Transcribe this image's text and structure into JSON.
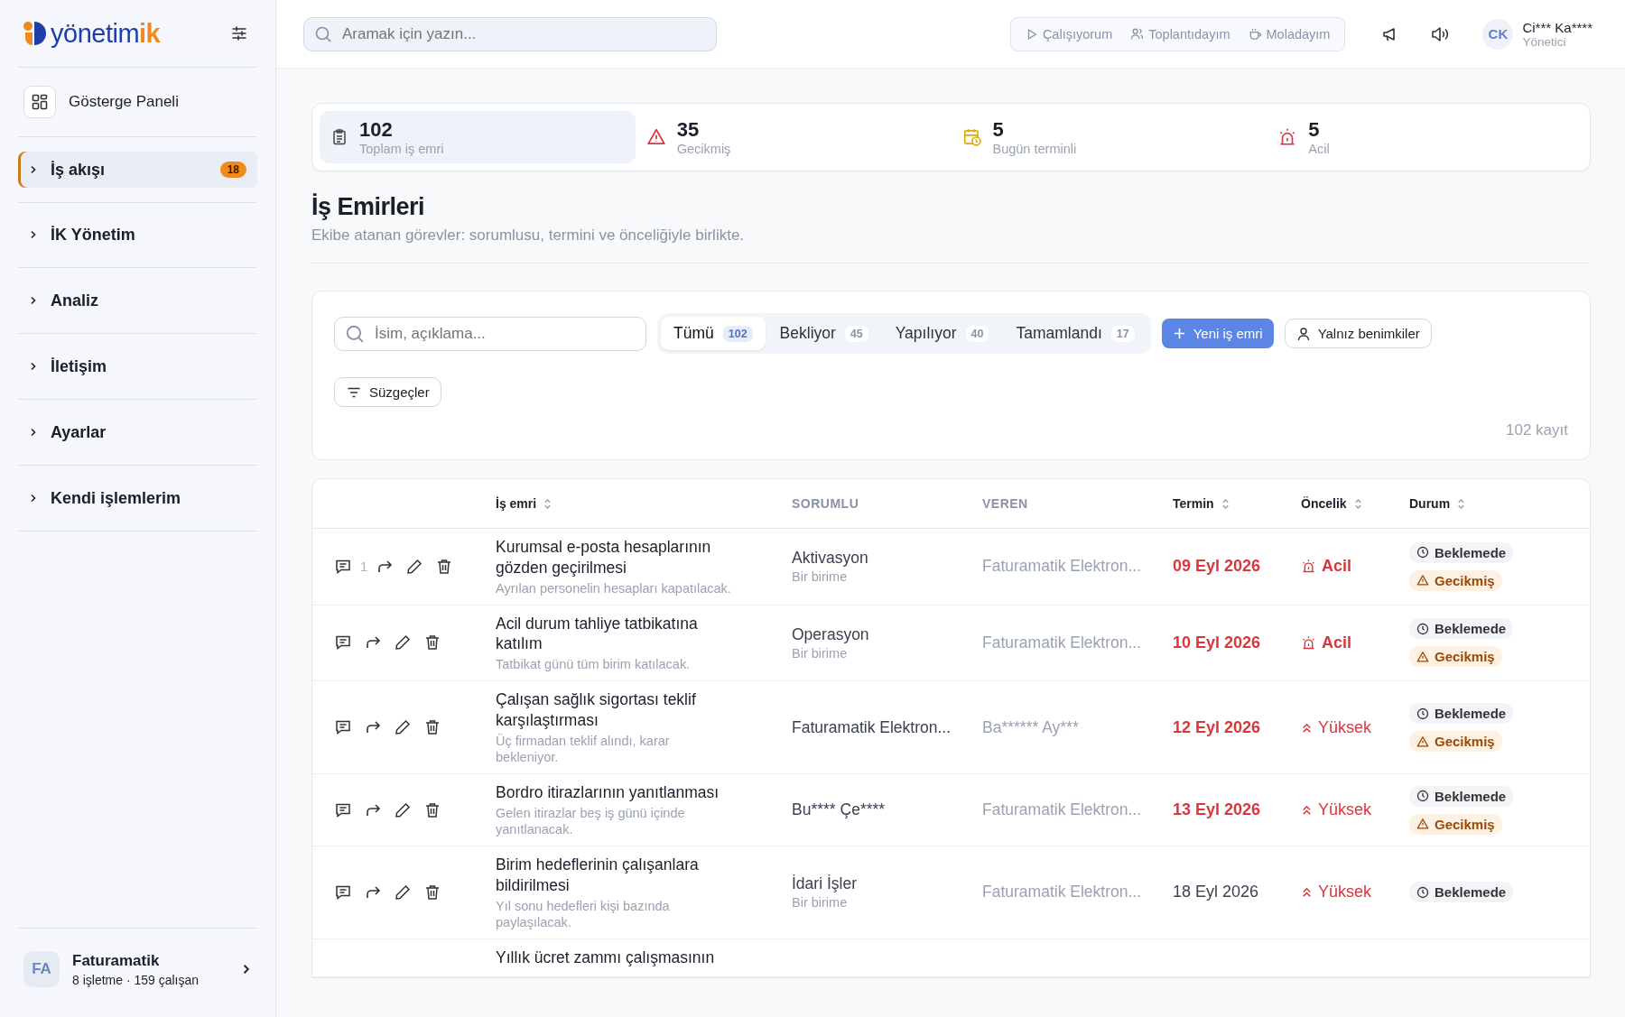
{
  "sidebar": {
    "logo": {
      "text": "yönetim",
      "accent": "ik"
    },
    "items": [
      {
        "label": "Gösterge Paneli",
        "kind": "link",
        "selected": false
      },
      {
        "label": "İş akışı",
        "kind": "group",
        "selected": true,
        "expanded": false,
        "badge": "18"
      },
      {
        "label": "İK Yönetim",
        "kind": "group",
        "selected": false,
        "expanded": false
      },
      {
        "label": "Analiz",
        "kind": "group",
        "selected": false,
        "expanded": false
      },
      {
        "label": "İletişim",
        "kind": "group",
        "selected": false,
        "expanded": false
      },
      {
        "label": "Ayarlar",
        "kind": "group",
        "selected": false,
        "expanded": false
      },
      {
        "label": "Kendi işlemlerim",
        "kind": "group",
        "selected": false,
        "expanded": false
      }
    ],
    "footer": {
      "initials": "FA",
      "name": "Faturamatik",
      "meta": "8 işletme · 159 çalışan"
    }
  },
  "topbar": {
    "search": {
      "placeholder": "Aramak için yazın..."
    },
    "status_buttons": [
      {
        "label": "Çalışıyorum",
        "kind": "working"
      },
      {
        "label": "Toplantıdayım",
        "kind": "meeting"
      },
      {
        "label": "Moladayım",
        "kind": "break"
      }
    ],
    "user": {
      "initials": "CK",
      "name": "Ci*** Ka****",
      "role": "Yönetici"
    }
  },
  "stats": [
    {
      "value": "102",
      "label": "Toplam iş emri",
      "kind": "total",
      "selected": true
    },
    {
      "value": "35",
      "label": "Gecikmiş",
      "kind": "late",
      "selected": false
    },
    {
      "value": "5",
      "label": "Bugün terminli",
      "kind": "today",
      "selected": false
    },
    {
      "value": "5",
      "label": "Acil",
      "kind": "urgent",
      "selected": false
    }
  ],
  "page": {
    "title": "İş Emirleri",
    "subtitle": "Ekibe atanan görevler: sorumlusu, termini ve önceliğiyle birlikte."
  },
  "filters": {
    "search": {
      "placeholder": "İsim, açıklama..."
    },
    "tabs": [
      {
        "label": "Tümü",
        "count": "102",
        "selected": true
      },
      {
        "label": "Bekliyor",
        "count": "45",
        "selected": false
      },
      {
        "label": "Yapılıyor",
        "count": "40",
        "selected": false
      },
      {
        "label": "Tamamlandı",
        "count": "17",
        "selected": false
      }
    ],
    "new_button": "Yeni iş emri",
    "mine_button": "Yalnız benimkiler",
    "filter_button": "Süzgeçler",
    "record_count": "102 kayıt"
  },
  "table": {
    "columns": [
      {
        "label": "İş emri",
        "sortable": true
      },
      {
        "label": "SORUMLU",
        "sortable": false
      },
      {
        "label": "VEREN",
        "sortable": false
      },
      {
        "label": "Termin",
        "sortable": true
      },
      {
        "label": "Öncelik",
        "sortable": true
      },
      {
        "label": "Durum",
        "sortable": true
      }
    ],
    "rows": [
      {
        "comment_count": "1",
        "title": "Kurumsal e-posta hesaplarının gözden geçirilmesi",
        "description": "Ayrılan personelin hesapları kapatılacak.",
        "assignee": "Aktivasyon",
        "assignee_note": "Bir birime",
        "giver": "Faturamatik Elektron...",
        "due": "09 Eyl 2026",
        "overdue": true,
        "priority": {
          "kind": "urgent",
          "label": "Acil"
        },
        "statuses": [
          {
            "kind": "pending",
            "label": "Beklemede"
          },
          {
            "kind": "late",
            "label": "Gecikmiş"
          }
        ]
      },
      {
        "title": "Acil durum tahliye tatbikatına katılım",
        "description": "Tatbikat günü tüm birim katılacak.",
        "assignee": "Operasyon",
        "assignee_note": "Bir birime",
        "giver": "Faturamatik Elektron...",
        "due": "10 Eyl 2026",
        "overdue": true,
        "priority": {
          "kind": "urgent",
          "label": "Acil"
        },
        "statuses": [
          {
            "kind": "pending",
            "label": "Beklemede"
          },
          {
            "kind": "late",
            "label": "Gecikmiş"
          }
        ]
      },
      {
        "title": "Çalışan sağlık sigortası teklif karşılaştırması",
        "description": "Üç firmadan teklif alındı, karar bekleniyor.",
        "assignee": "Faturamatik Elektron...",
        "giver": "Ba****** Ay***",
        "due": "12 Eyl 2026",
        "overdue": true,
        "priority": {
          "kind": "high",
          "label": "Yüksek"
        },
        "statuses": [
          {
            "kind": "pending",
            "label": "Beklemede"
          },
          {
            "kind": "late",
            "label": "Gecikmiş"
          }
        ]
      },
      {
        "title": "Bordro itirazlarının yanıtlanması",
        "description": "Gelen itirazlar beş iş günü içinde yanıtlanacak.",
        "assignee": "Bu**** Çe****",
        "giver": "Faturamatik Elektron...",
        "due": "13 Eyl 2026",
        "overdue": true,
        "priority": {
          "kind": "high",
          "label": "Yüksek"
        },
        "statuses": [
          {
            "kind": "pending",
            "label": "Beklemede"
          },
          {
            "kind": "late",
            "label": "Gecikmiş"
          }
        ]
      },
      {
        "title": "Birim hedeflerinin çalışanlara bildirilmesi",
        "description": "Yıl sonu hedefleri kişi bazında paylaşılacak.",
        "assignee": "İdari İşler",
        "assignee_note": "Bir birime",
        "giver": "Faturamatik Elektron...",
        "due": "18 Eyl 2026",
        "overdue": false,
        "priority": {
          "kind": "high",
          "label": "Yüksek"
        },
        "statuses": [
          {
            "kind": "pending",
            "label": "Beklemede"
          }
        ]
      },
      {
        "title": "Yıllık ücret zammı çalışmasının"
      }
    ]
  }
}
